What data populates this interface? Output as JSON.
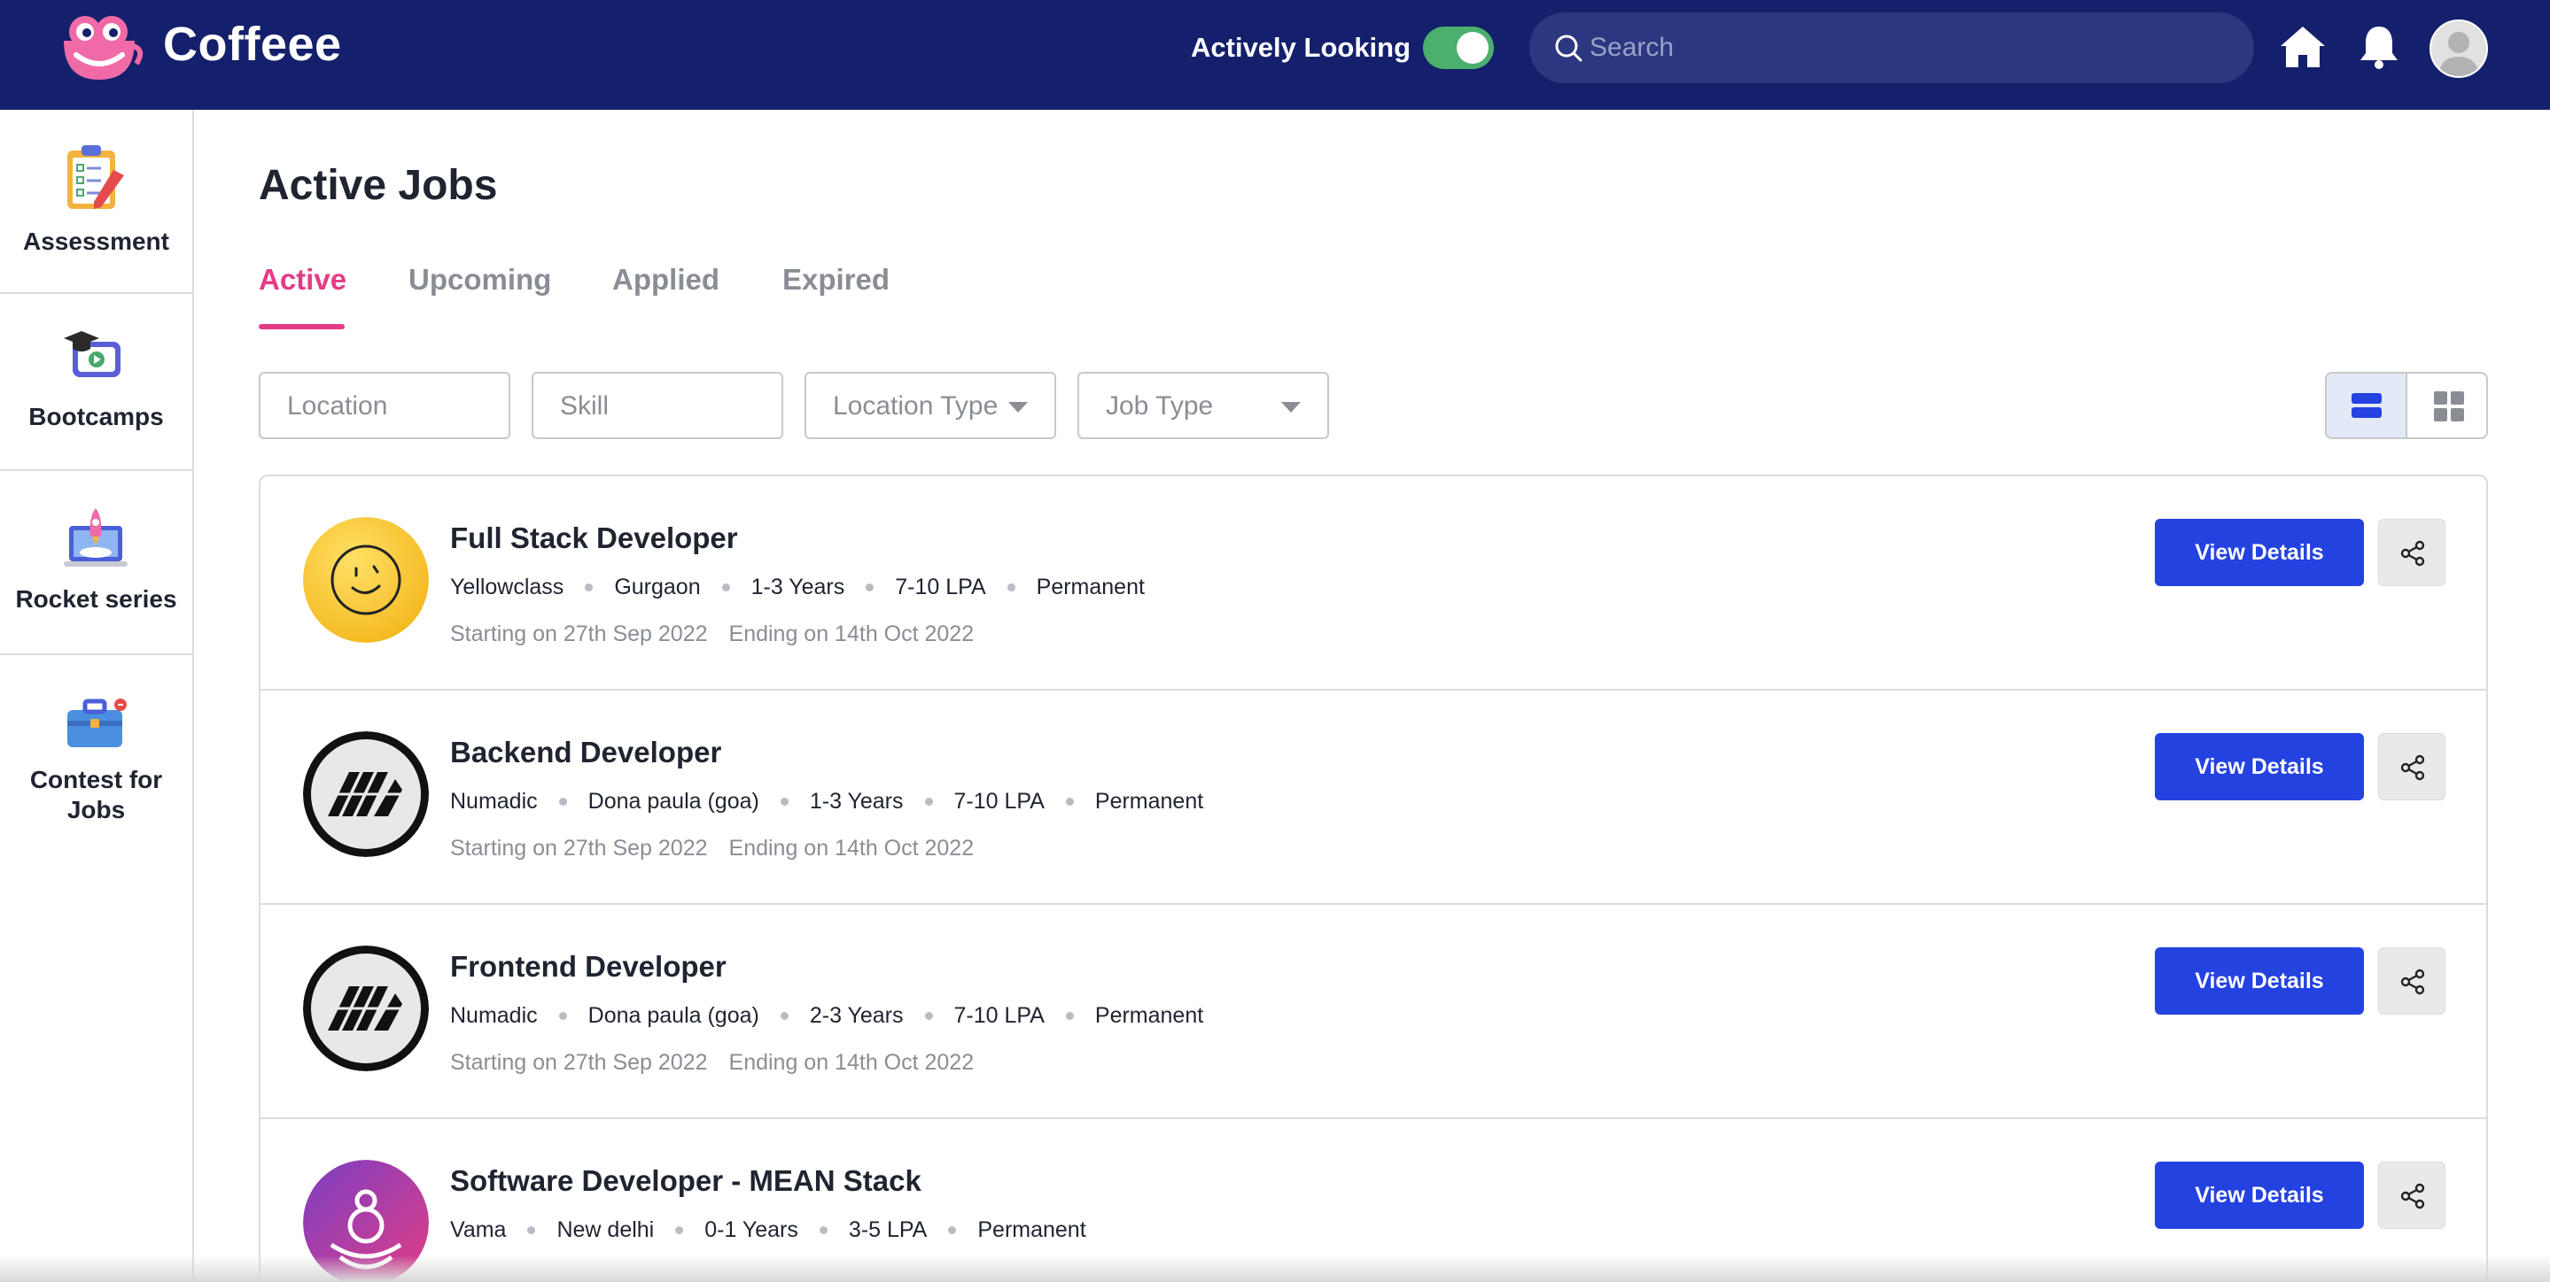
{
  "header": {
    "brand": "Coffeee",
    "actively_looking_label": "Actively Looking",
    "actively_looking_on": true,
    "search_placeholder": "Search"
  },
  "sidebar": {
    "items": [
      {
        "label": "Assessment",
        "icon": "clipboard-checklist-icon"
      },
      {
        "label": "Bootcamps",
        "icon": "graduation-video-icon"
      },
      {
        "label": "Rocket series",
        "icon": "rocket-laptop-icon"
      },
      {
        "label": "Contest for Jobs",
        "icon": "briefcase-icon"
      }
    ]
  },
  "main": {
    "title": "Active Jobs",
    "tabs": [
      {
        "label": "Active",
        "active": true
      },
      {
        "label": "Upcoming",
        "active": false
      },
      {
        "label": "Applied",
        "active": false
      },
      {
        "label": "Expired",
        "active": false
      }
    ],
    "filters": {
      "location_placeholder": "Location",
      "skill_placeholder": "Skill",
      "location_type_label": "Location Type",
      "job_type_label": "Job Type"
    },
    "view_mode": "list"
  },
  "jobs": [
    {
      "title": "Full Stack Developer",
      "company": "Yellowclass",
      "location": "Gurgaon",
      "experience": "1-3 Years",
      "salary": "7-10 LPA",
      "type": "Permanent",
      "start": "Starting on 27th Sep 2022",
      "end": "Ending on 14th Oct 2022",
      "button": "View Details",
      "logo": "yellowclass-smiley-logo"
    },
    {
      "title": "Backend Developer",
      "company": "Numadic",
      "location": "Dona paula (goa)",
      "experience": "1-3 Years",
      "salary": "7-10 LPA",
      "type": "Permanent",
      "start": "Starting on 27th Sep 2022",
      "end": "Ending on 14th Oct 2022",
      "button": "View Details",
      "logo": "numadic-logo"
    },
    {
      "title": "Frontend Developer",
      "company": "Numadic",
      "location": "Dona paula (goa)",
      "experience": "2-3 Years",
      "salary": "7-10 LPA",
      "type": "Permanent",
      "start": "Starting on 27th Sep 2022",
      "end": "Ending on 14th Oct 2022",
      "button": "View Details",
      "logo": "numadic-logo"
    },
    {
      "title": "Software Developer - MEAN Stack",
      "company": "Vama",
      "location": "New delhi",
      "experience": "0-1 Years",
      "salary": "3-5 LPA",
      "type": "Permanent",
      "start": "",
      "end": "",
      "button": "View Details",
      "logo": "vama-logo"
    }
  ],
  "colors": {
    "header_bg": "#14206b",
    "accent_pink": "#e53b87",
    "primary_button": "#2342e0",
    "toggle_on": "#4caf6e"
  }
}
